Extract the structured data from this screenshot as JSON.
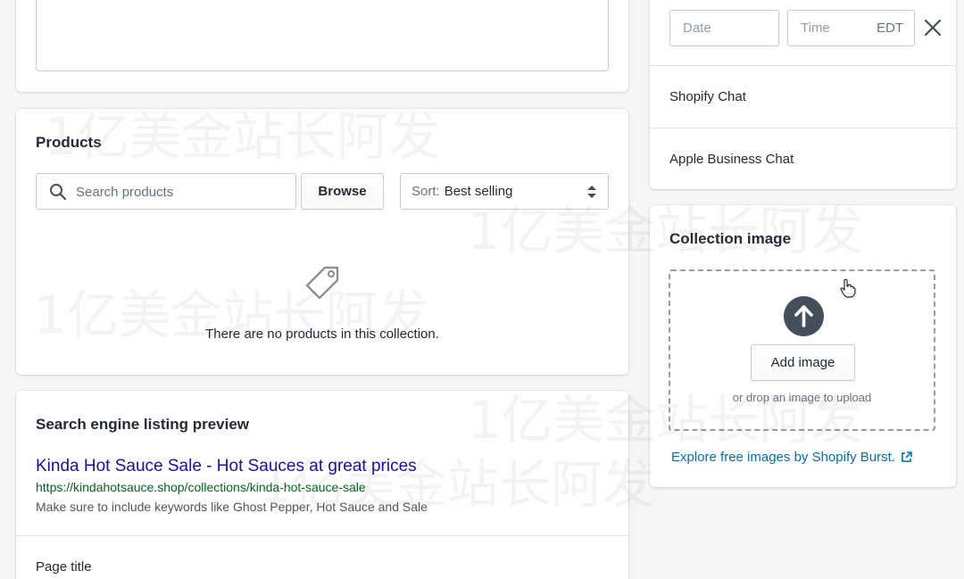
{
  "description": {},
  "products": {
    "title": "Products",
    "search_placeholder": "Search products",
    "browse_label": "Browse",
    "sort_prefix": "Sort:",
    "sort_value": "Best selling",
    "empty_text": "There are no products in this collection."
  },
  "seo": {
    "title": "Search engine listing preview",
    "link_title": "Kinda Hot Sauce Sale - Hot Sauces at great prices",
    "url": "https://kindahotsauce.shop/collections/kinda-hot-sauce-sale",
    "description": "Make sure to include keywords like Ghost Pepper, Hot Sauce and Sale",
    "page_title_label": "Page title"
  },
  "availability": {
    "date_placeholder": "Date",
    "time_placeholder": "Time",
    "timezone": "EDT",
    "channels": [
      "Shopify Chat",
      "Apple Business Chat"
    ]
  },
  "collection_image": {
    "title": "Collection image",
    "add_image_label": "Add image",
    "drop_hint": "or drop an image to upload",
    "burst_link": "Explore free images by Shopify Burst."
  },
  "watermark": "1亿美金站长阿发",
  "icons": {
    "search": "search-icon",
    "sort": "sort-arrows-icon",
    "tag": "tag-icon",
    "close": "close-icon",
    "upload": "upload-icon",
    "external": "external-link-icon"
  },
  "colors": {
    "link_blue": "#1a0dab",
    "url_green": "#006621",
    "shopify_link": "#006fbb",
    "upload_circle": "#454f5b"
  }
}
